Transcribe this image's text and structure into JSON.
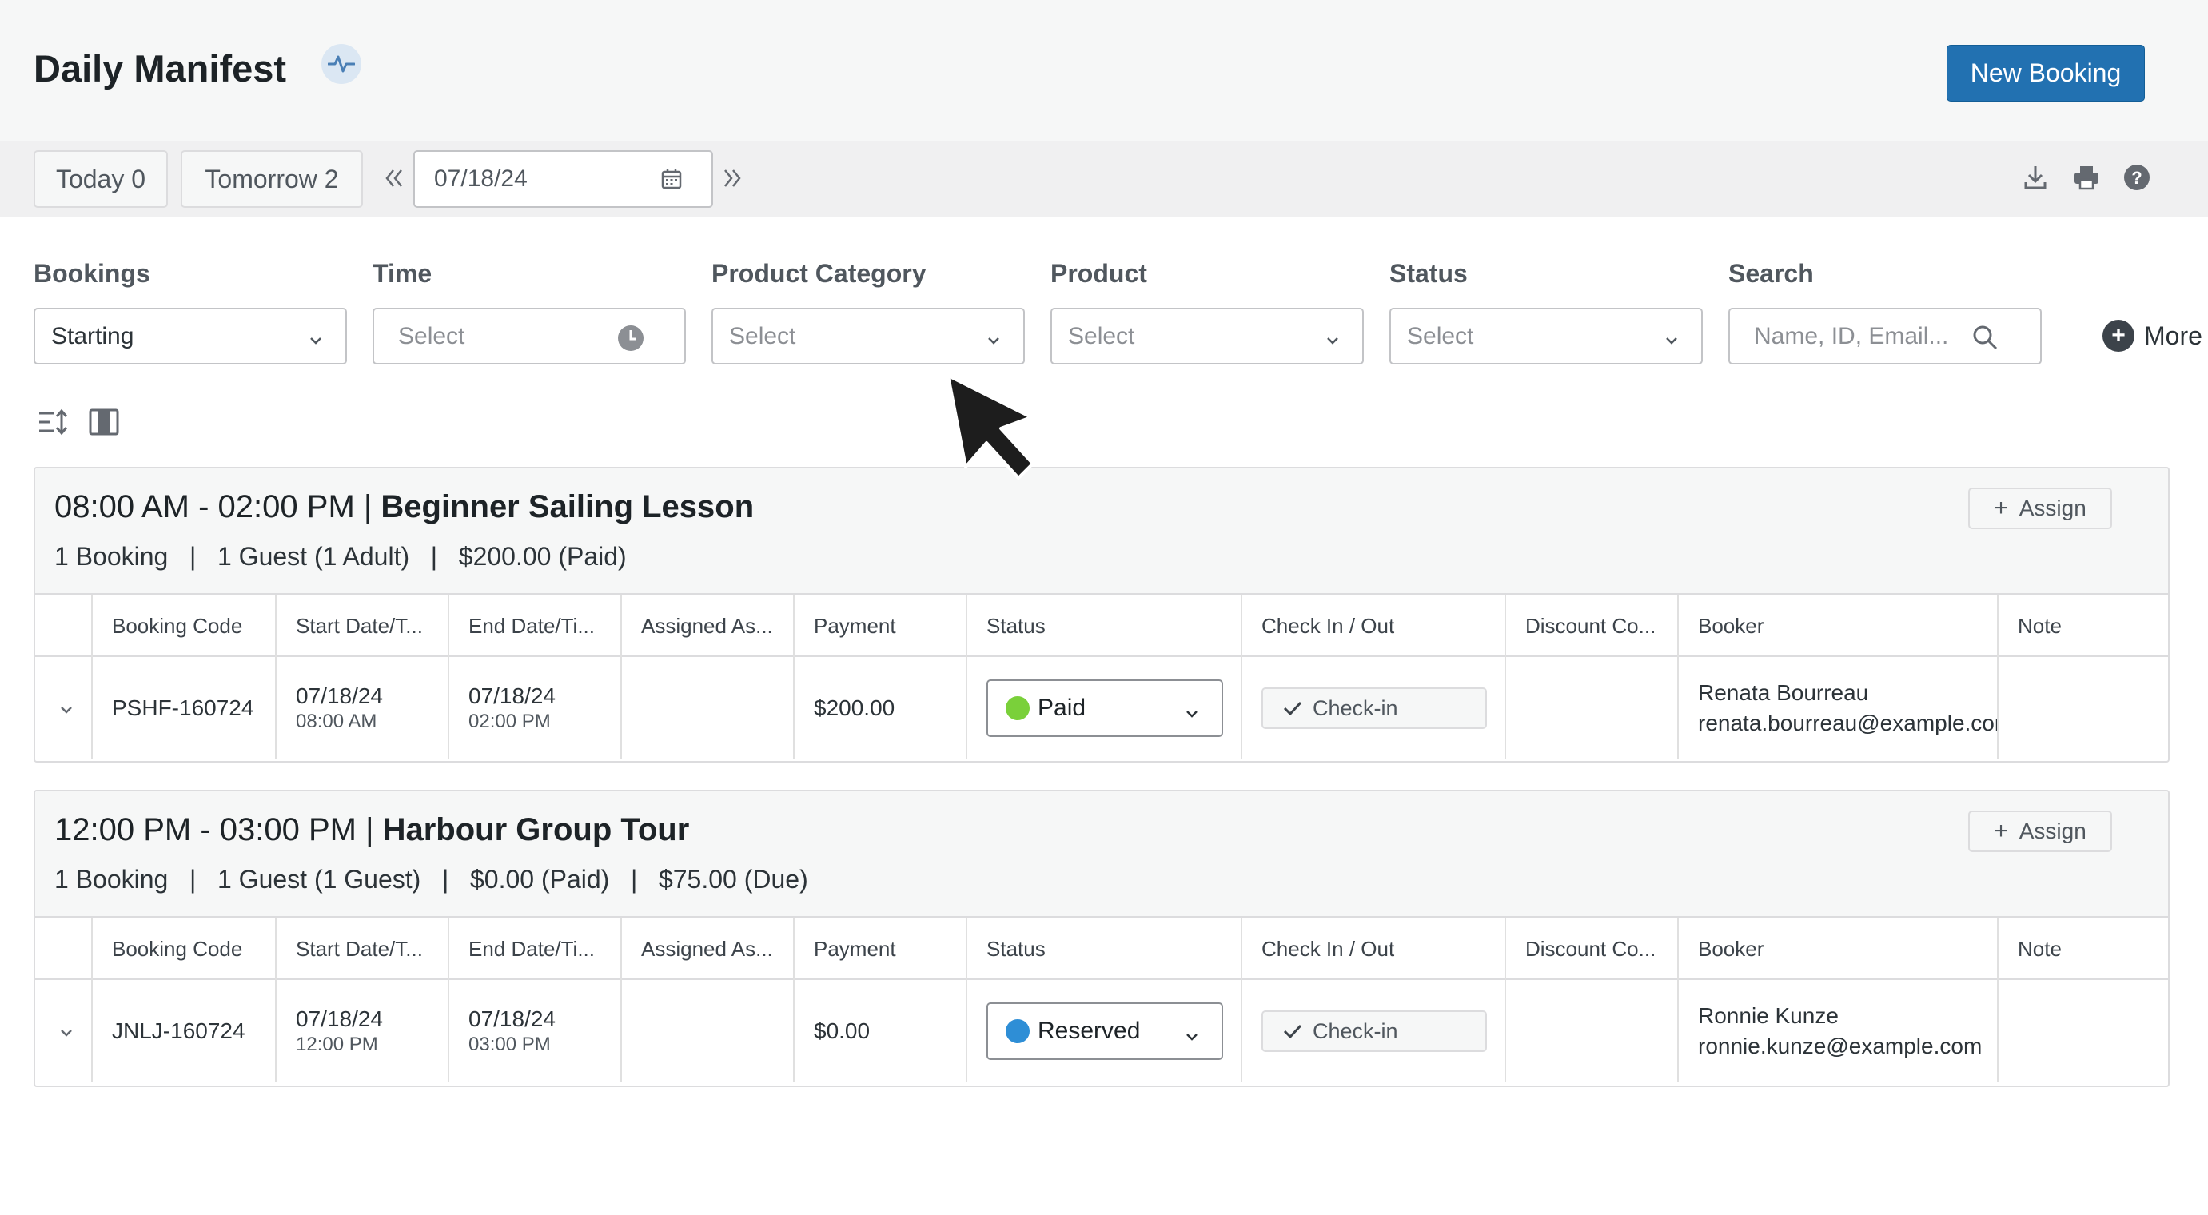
{
  "header": {
    "title": "Daily Manifest",
    "new_booking_label": "New Booking",
    "status_icon": "activity-pulse-icon"
  },
  "toolbar": {
    "today_label": "Today 0",
    "tomorrow_label": "Tomorrow 2",
    "date_value": "07/18/24",
    "icons": [
      "double-chevron-left-icon",
      "calendar-icon",
      "double-chevron-right-icon",
      "download-icon",
      "print-icon",
      "help-icon"
    ]
  },
  "filters": {
    "bookings": {
      "label": "Bookings",
      "value": "Starting"
    },
    "time": {
      "label": "Time",
      "placeholder": "Select"
    },
    "product_category": {
      "label": "Product Category",
      "placeholder": "Select"
    },
    "product": {
      "label": "Product",
      "placeholder": "Select"
    },
    "status": {
      "label": "Status",
      "placeholder": "Select"
    },
    "search": {
      "label": "Search",
      "placeholder": "Name, ID, Email..."
    },
    "more_label": "More"
  },
  "table_columns": [
    "Booking Code",
    "Start Date/T...",
    "End Date/Ti...",
    "Assigned As...",
    "Payment",
    "Status",
    "Check In / Out",
    "Discount Co...",
    "Booker",
    "Note"
  ],
  "groups": [
    {
      "time_range": "08:00 AM - 02:00 PM |",
      "product": "Beginner Sailing Lesson",
      "summary": "1 Booking   |   1 Guest (1 Adult)   |   $200.00 (Paid)",
      "assign_label": "Assign",
      "row": {
        "booking_code": "PSHF-160724",
        "start_date": "07/18/24",
        "start_time": "08:00 AM",
        "end_date": "07/18/24",
        "end_time": "02:00 PM",
        "assigned": "",
        "payment": "$200.00",
        "status": "Paid",
        "status_color": "#7ad03a",
        "checkin_label": "Check-in",
        "discount": "",
        "booker_name": "Renata Bourreau",
        "booker_email": "renata.bourreau@example.com",
        "note": ""
      }
    },
    {
      "time_range": "12:00 PM - 03:00 PM |",
      "product": "Harbour Group Tour",
      "summary": "1 Booking   |   1 Guest (1 Guest)   |   $0.00 (Paid)   |   $75.00 (Due)",
      "assign_label": "Assign",
      "row": {
        "booking_code": "JNLJ-160724",
        "start_date": "07/18/24",
        "start_time": "12:00 PM",
        "end_date": "07/18/24",
        "end_time": "03:00 PM",
        "assigned": "",
        "payment": "$0.00",
        "status": "Reserved",
        "status_color": "#2e8ed6",
        "checkin_label": "Check-in",
        "discount": "",
        "booker_name": "Ronnie Kunze",
        "booker_email": "ronnie.kunze@example.com",
        "note": ""
      }
    }
  ],
  "colors": {
    "primary": "#2271b1",
    "paid": "#7ad03a",
    "reserved": "#2e8ed6"
  }
}
